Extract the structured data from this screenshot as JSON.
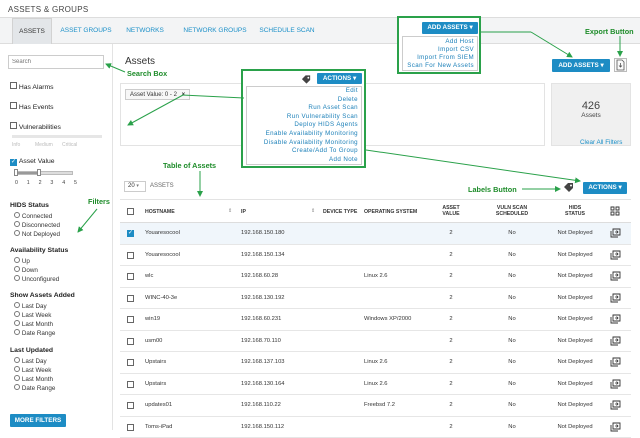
{
  "app": {
    "title": "ASSETS & GROUPS"
  },
  "tabs": [
    {
      "label": "ASSETS"
    },
    {
      "label": "ASSET GROUPS"
    },
    {
      "label": "NETWORKS"
    },
    {
      "label": "NETWORK GROUPS"
    },
    {
      "label": "SCHEDULE SCAN"
    }
  ],
  "sidebar": {
    "search_placeholder": "Search",
    "has_alarms": "Has Alarms",
    "has_events": "Has Events",
    "vulnerabilities": "Vulnerabilities",
    "vuln_levels": [
      "Info",
      "Medium",
      "Critical"
    ],
    "asset_value": "Asset Value",
    "asset_value_ticks": [
      "0",
      "1",
      "2",
      "3",
      "4",
      "5"
    ],
    "hids": {
      "title": "HIDS Status",
      "options": [
        "Connected",
        "Disconnected",
        "Not Deployed"
      ]
    },
    "availability": {
      "title": "Availability Status",
      "options": [
        "Up",
        "Down",
        "Unconfigured"
      ]
    },
    "show_added": {
      "title": "Show Assets Added",
      "options": [
        "Last Day",
        "Last Week",
        "Last Month",
        "Date Range"
      ]
    },
    "last_updated": {
      "title": "Last Updated",
      "options": [
        "Last Day",
        "Last Week",
        "Last Month",
        "Date Range"
      ]
    },
    "more_filters": "MORE FILTERS"
  },
  "main": {
    "heading": "Assets",
    "filter_tag": "Asset Value: 0 - 2",
    "count": "426",
    "count_label": "Assets",
    "clear_all": "Clear All Filters",
    "page_size": "20",
    "page_size_label": "ASSETS",
    "actions_label": "ACTIONS",
    "add_assets_label": "ADD ASSETS",
    "columns": [
      "HOSTNAME",
      "IP",
      "DEVICE TYPE",
      "OPERATING SYSTEM",
      "ASSET VALUE",
      "VULN SCAN SCHEDULED",
      "HIDS STATUS"
    ],
    "rows": [
      {
        "hostname": "Youaresocool",
        "ip": "192.168.150.180",
        "device": "",
        "os": "",
        "value": "2",
        "vuln": "No",
        "hids": "Not Deployed",
        "checked": true
      },
      {
        "hostname": "Youaresocool",
        "ip": "192.168.150.134",
        "device": "",
        "os": "",
        "value": "2",
        "vuln": "No",
        "hids": "Not Deployed",
        "checked": false
      },
      {
        "hostname": "wlc",
        "ip": "192.168.60.28",
        "device": "",
        "os": "Linux 2.6",
        "value": "2",
        "vuln": "No",
        "hids": "Not Deployed",
        "checked": false
      },
      {
        "hostname": "WINC-40-3e",
        "ip": "192.168.130.192",
        "device": "",
        "os": "",
        "value": "2",
        "vuln": "No",
        "hids": "Not Deployed",
        "checked": false
      },
      {
        "hostname": "win19",
        "ip": "192.168.60.231",
        "device": "",
        "os": "Windows XP/2000",
        "value": "2",
        "vuln": "No",
        "hids": "Not Deployed",
        "checked": false
      },
      {
        "hostname": "usm00",
        "ip": "192.168.70.110",
        "device": "",
        "os": "",
        "value": "2",
        "vuln": "No",
        "hids": "Not Deployed",
        "checked": false
      },
      {
        "hostname": "Upstairs",
        "ip": "192.168.137.103",
        "device": "",
        "os": "Linux 2.6",
        "value": "2",
        "vuln": "No",
        "hids": "Not Deployed",
        "checked": false
      },
      {
        "hostname": "Upstairs",
        "ip": "192.168.130.164",
        "device": "",
        "os": "Linux 2.6",
        "value": "2",
        "vuln": "No",
        "hids": "Not Deployed",
        "checked": false
      },
      {
        "hostname": "updates01",
        "ip": "192.168.110.22",
        "device": "",
        "os": "Freebsd 7.2",
        "value": "2",
        "vuln": "No",
        "hids": "Not Deployed",
        "checked": false
      },
      {
        "hostname": "Toms-iPad",
        "ip": "192.168.150.112",
        "device": "",
        "os": "",
        "value": "2",
        "vuln": "No",
        "hids": "Not Deployed",
        "checked": false
      }
    ]
  },
  "actions_menu": {
    "label": "ACTIONS",
    "items": [
      "Edit",
      "Delete",
      "Run Asset Scan",
      "Run Vulnerability Scan",
      "Deploy HIDS Agents",
      "Enable Availability Monitoring",
      "Disable Availability Monitoring",
      "Create/Add To Group",
      "Add Note"
    ]
  },
  "add_menu": {
    "label": "ADD ASSETS",
    "items": [
      "Add Host",
      "Import CSV",
      "Import From SIEM",
      "Scan For New Assets"
    ]
  },
  "callouts": {
    "search": "Search Box",
    "filters": "Filters",
    "table": "Table of Assets",
    "labels": "Labels Button",
    "export": "Export Button"
  },
  "colors": {
    "accent": "#1d8cc4",
    "callout": "#2aa14a",
    "link": "#1a8fc8"
  }
}
